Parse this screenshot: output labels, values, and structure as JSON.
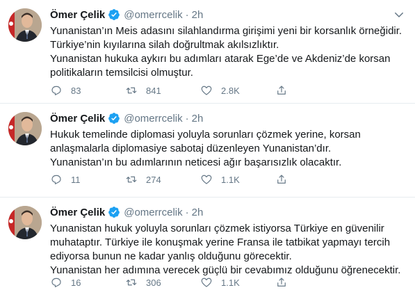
{
  "colors": {
    "verified": "#1da1f2",
    "icon": "#657786",
    "text": "#14171a",
    "divider": "#e6ecf0"
  },
  "tweets": [
    {
      "author_name": "Ömer Çelik",
      "handle": "@omerrcelik",
      "separator": "·",
      "time": "2h",
      "lines": [
        "Yunanistan’ın Meis adasını silahlandırma girişimi yeni bir korsanlık örneğidir.",
        "Türkiye’nin kıyılarına silah doğrultmak akılsızlıktır.",
        "Yunanistan hukuka aykırı bu adımları atarak Ege’de ve Akdeniz’de korsan",
        "politikaların temsilcisi olmuştur."
      ],
      "replies": "83",
      "retweets": "841",
      "likes": "2.8K"
    },
    {
      "author_name": "Ömer Çelik",
      "handle": "@omerrcelik",
      "separator": "·",
      "time": "2h",
      "lines": [
        "Hukuk temelinde diplomasi yoluyla sorunları çözmek yerine, korsan",
        "anlaşmalarla diplomasiye sabotaj düzenleyen Yunanistan’dır.",
        "Yunanistan’ın bu adımlarının neticesi  ağır başarısızlık olacaktır."
      ],
      "replies": "11",
      "retweets": "274",
      "likes": "1.1K"
    },
    {
      "author_name": "Ömer Çelik",
      "handle": "@omerrcelik",
      "separator": "·",
      "time": "2h",
      "lines": [
        "Yunanistan hukuk yoluyla sorunları çözmek istiyorsa Türkiye en güvenilir",
        "muhataptır. Türkiye ile konuşmak  yerine Fransa ile tatbikat yapmayı tercih",
        "ediyorsa bunun ne kadar yanlış olduğunu görecektir.",
        "Yunanistan her adımına verecek güçlü bir cevabımız olduğunu öğrenecektir."
      ],
      "replies": "16",
      "retweets": "306",
      "likes": "1.1K"
    }
  ]
}
